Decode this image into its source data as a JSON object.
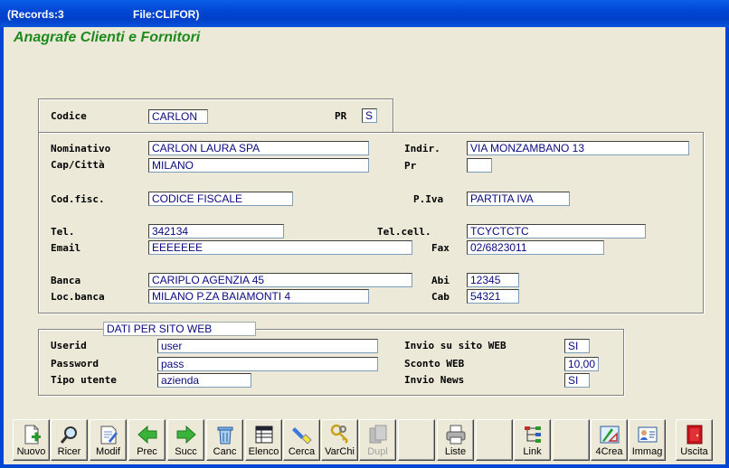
{
  "window": {
    "records": "(Records:3",
    "file": "File:CLIFOR)"
  },
  "app_title": "Anagrafe Clienti e Fornitori",
  "top": {
    "codice_label": "Codice",
    "codice_value": "CARLON",
    "pr_label": "PR",
    "pr_value": "S"
  },
  "main": {
    "nominativo_label": "Nominativo",
    "nominativo_value": "CARLON LAURA SPA",
    "indir_label": "Indir.",
    "indir_value": "VIA MONZAMBANO 13",
    "cap_label": "Cap/Città",
    "cap_value": "MILANO",
    "pr_label": "Pr",
    "pr_value": "",
    "codfisc_label": "Cod.fisc.",
    "codfisc_value": "CODICE FISCALE",
    "piva_label": "P.Iva",
    "piva_value": "PARTITA IVA",
    "tel_label": "Tel.",
    "tel_value": "342134",
    "telcell_label": "Tel.cell.",
    "telcell_value": "TCYCTCTC",
    "email_label": "Email",
    "email_value": "EEEEEEE",
    "fax_label": "Fax",
    "fax_value": "02/6823011",
    "banca_label": "Banca",
    "banca_value": "CARIPLO AGENZIA 45",
    "abi_label": "Abi",
    "abi_value": "12345",
    "locbanca_label": "Loc.banca",
    "locbanca_value": "MILANO P.ZA BAIAMONTI 4",
    "cab_label": "Cab",
    "cab_value": "54321"
  },
  "web": {
    "title": "DATI PER SITO WEB",
    "userid_label": "Userid",
    "userid_value": "user",
    "password_label": "Password",
    "password_value": "pass",
    "tipo_label": "Tipo utente",
    "tipo_value": "azienda",
    "invio_sito_label": "Invio su sito WEB",
    "invio_sito_value": "SI",
    "sconto_label": "Sconto WEB",
    "sconto_value": "10,00",
    "invio_news_label": "Invio News",
    "invio_news_value": "SI"
  },
  "toolbar": {
    "nuovo": "Nuovo",
    "ricer": "Ricer",
    "modif": "Modif",
    "prec": "Prec",
    "succ": "Succ",
    "canc": "Canc",
    "elenco": "Elenco",
    "cerca": "Cerca",
    "varchi": "VarChi",
    "dupl": "Dupl",
    "liste": "Liste",
    "link": "Link",
    "crea": "4Crea",
    "immag": "Immag",
    "uscita": "Uscita"
  },
  "colors": {
    "title_green": "#1D8A1D",
    "field_text": "#0A0A80",
    "titlebar_blue": "#0046D5"
  }
}
